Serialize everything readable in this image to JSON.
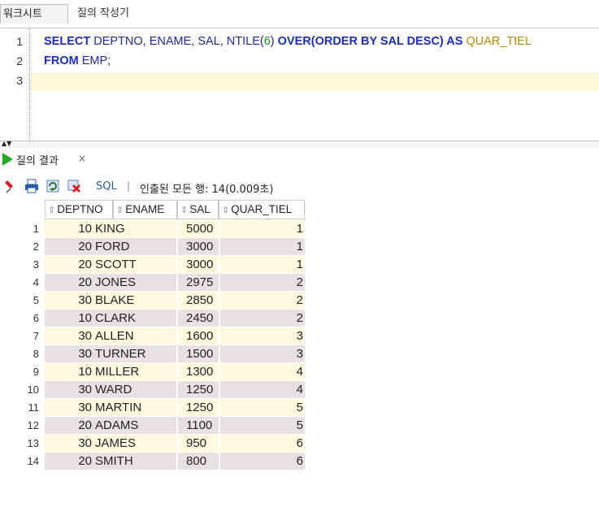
{
  "tabs": {
    "worksheet": "워크시트",
    "query_builder": "질의 작성기"
  },
  "editor": {
    "line_numbers": [
      "1",
      "2",
      "3"
    ],
    "line1": {
      "select": "SELECT",
      "cols": " DEPTNO, ENAME, SAL, NTILE(",
      "num": "6",
      "close": ") ",
      "over": "OVER(ORDER BY SAL DESC)",
      "as": " AS ",
      "alias": "QUAR_TIEL"
    },
    "line2": {
      "from": "FROM",
      "table": " EMP;"
    }
  },
  "result_panel": {
    "tab_label": "질의 결과",
    "close_glyph": "×",
    "sql_link": "SQL",
    "separator": "|",
    "status": "인출된 모든 행: 14(0.009초)"
  },
  "colors": {
    "row_odd": "#fffadf",
    "row_even": "#e6e1e2",
    "sal_odd": "#fffadf",
    "sal_even": "#e6e1e2"
  },
  "grid": {
    "columns": [
      "DEPTNO",
      "ENAME",
      "SAL",
      "QUAR_TIEL"
    ],
    "rows": [
      {
        "n": "1",
        "deptno": "10",
        "ename": "KING",
        "sal": "5000",
        "quar": "1"
      },
      {
        "n": "2",
        "deptno": "20",
        "ename": "FORD",
        "sal": "3000",
        "quar": "1"
      },
      {
        "n": "3",
        "deptno": "20",
        "ename": "SCOTT",
        "sal": "3000",
        "quar": "1"
      },
      {
        "n": "4",
        "deptno": "20",
        "ename": "JONES",
        "sal": "2975",
        "quar": "2"
      },
      {
        "n": "5",
        "deptno": "30",
        "ename": "BLAKE",
        "sal": "2850",
        "quar": "2"
      },
      {
        "n": "6",
        "deptno": "10",
        "ename": "CLARK",
        "sal": "2450",
        "quar": "2"
      },
      {
        "n": "7",
        "deptno": "30",
        "ename": "ALLEN",
        "sal": "1600",
        "quar": "3"
      },
      {
        "n": "8",
        "deptno": "30",
        "ename": "TURNER",
        "sal": "1500",
        "quar": "3"
      },
      {
        "n": "9",
        "deptno": "10",
        "ename": "MILLER",
        "sal": "1300",
        "quar": "4"
      },
      {
        "n": "10",
        "deptno": "30",
        "ename": "WARD",
        "sal": "1250",
        "quar": "4"
      },
      {
        "n": "11",
        "deptno": "30",
        "ename": "MARTIN",
        "sal": "1250",
        "quar": "5"
      },
      {
        "n": "12",
        "deptno": "20",
        "ename": "ADAMS",
        "sal": "1100",
        "quar": "5"
      },
      {
        "n": "13",
        "deptno": "30",
        "ename": "JAMES",
        "sal": "950",
        "quar": "6"
      },
      {
        "n": "14",
        "deptno": "20",
        "ename": "SMITH",
        "sal": "800",
        "quar": "6"
      }
    ]
  }
}
